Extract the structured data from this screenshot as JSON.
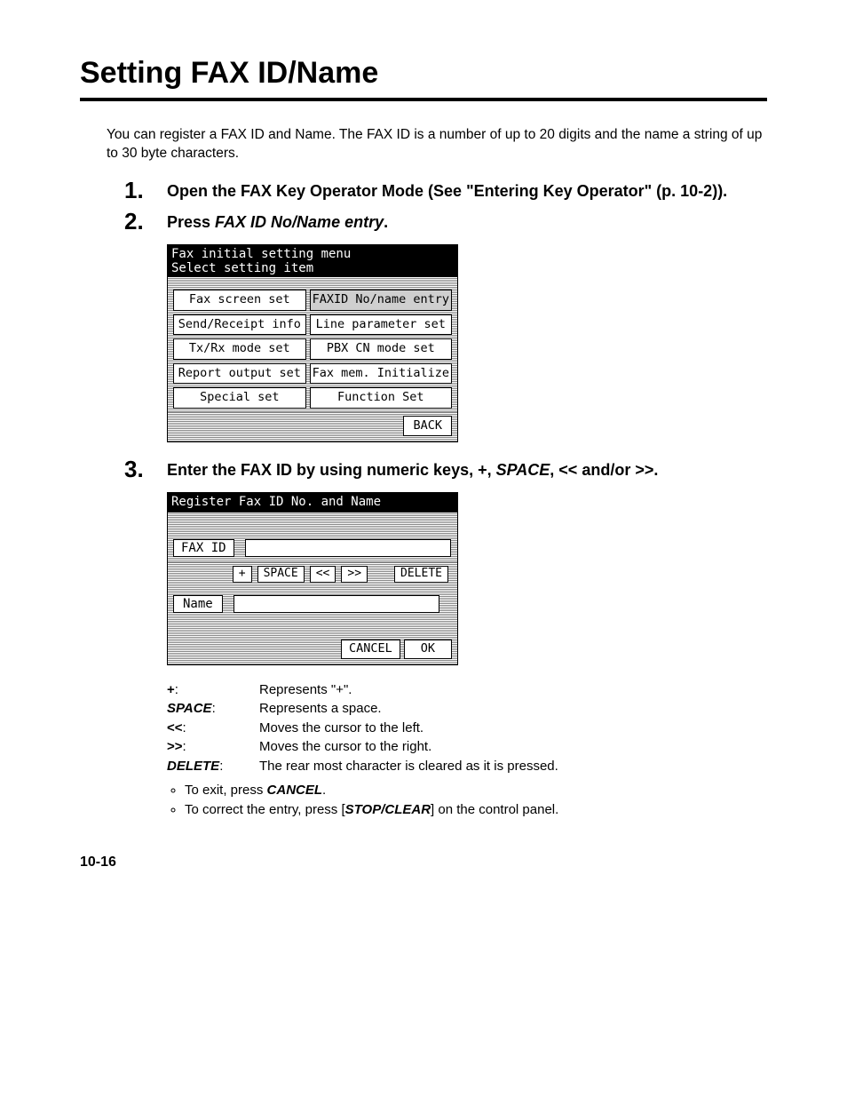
{
  "title": "Setting FAX ID/Name",
  "intro": "You can register a FAX ID and Name. The FAX ID is a number of up to 20 digits and the name a string of up to 30 byte characters.",
  "steps": {
    "s1": {
      "num": "1.",
      "text_a": "Open the FAX Key Operator Mode (See \"Entering Key Operator\" (p. 10-2))."
    },
    "s2": {
      "num": "2.",
      "text_a": "Press ",
      "it": "FAX ID No/Name entry",
      "text_b": "."
    },
    "s3": {
      "num": "3.",
      "text_a": "Enter the FAX ID by using numeric keys, +, ",
      "it": "SPACE",
      "text_b": ", << and/or >>."
    }
  },
  "screen1": {
    "header": "Fax initial setting menu\nSelect setting item",
    "buttons": [
      [
        "Fax screen set",
        "FAXID No/name entry"
      ],
      [
        "Send/Receipt info",
        "Line parameter set"
      ],
      [
        "Tx/Rx mode set",
        "PBX CN mode set"
      ],
      [
        "Report output set",
        "Fax mem. Initialize"
      ],
      [
        "Special set",
        "Function Set"
      ]
    ],
    "back": "BACK"
  },
  "screen2": {
    "header": "Register Fax ID No. and Name",
    "faxid_label": "FAX ID",
    "name_label": "Name",
    "btn_plus": "+",
    "btn_space": "SPACE",
    "btn_left": "<<",
    "btn_right": ">>",
    "btn_delete": "DELETE",
    "cancel": "CANCEL",
    "ok": "OK"
  },
  "defs": [
    {
      "term_b": "+",
      "term_i": "",
      "colon": ":",
      "desc": "Represents \"+\"."
    },
    {
      "term_b": "",
      "term_i": "SPACE",
      "colon": ":",
      "desc": "Represents a space."
    },
    {
      "term_b": "<<",
      "term_i": "",
      "colon": ":",
      "desc": "Moves the cursor to the left."
    },
    {
      "term_b": ">>",
      "term_i": "",
      "colon": ":",
      "desc": "Moves the cursor to the right."
    },
    {
      "term_b": "",
      "term_i": "DELETE",
      "colon": ":",
      "desc": "The rear most character is cleared as it is pressed."
    }
  ],
  "bullets": {
    "b1_a": "To exit, press ",
    "b1_b": "CANCEL",
    "b1_c": ".",
    "b2_a": "To correct the entry, press [",
    "b2_b": "STOP/CLEAR",
    "b2_c": "] on the control panel."
  },
  "pagenum": "10-16"
}
